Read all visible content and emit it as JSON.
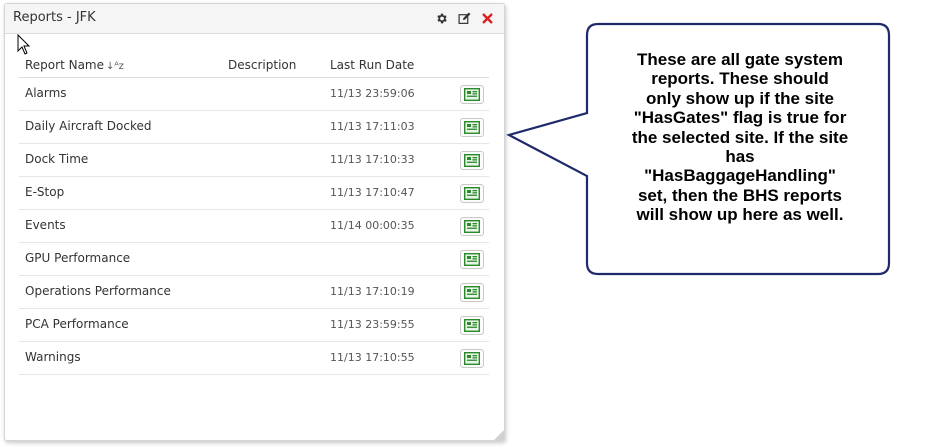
{
  "window": {
    "title": "Reports - JFK"
  },
  "icons": {
    "settings": "gear-icon",
    "edit": "edit-icon",
    "close": "close-icon",
    "run": "report-icon",
    "sort": "sort-ascending-icon"
  },
  "colors": {
    "close": "#dd1f1f",
    "run_icon": "#2a8a2a",
    "callout_border": "#1f2a6b"
  },
  "table": {
    "headers": {
      "name": "Report Name",
      "description": "Description",
      "last_run": "Last Run Date"
    },
    "rows": [
      {
        "name": "Alarms",
        "description": "",
        "last_run": "11/13 23:59:06"
      },
      {
        "name": "Daily Aircraft Docked",
        "description": "",
        "last_run": "11/13 17:11:03"
      },
      {
        "name": "Dock Time",
        "description": "",
        "last_run": "11/13 17:10:33"
      },
      {
        "name": "E-Stop",
        "description": "",
        "last_run": "11/13 17:10:47"
      },
      {
        "name": "Events",
        "description": "",
        "last_run": "11/14 00:00:35"
      },
      {
        "name": "GPU Performance",
        "description": "",
        "last_run": ""
      },
      {
        "name": "Operations Performance",
        "description": "",
        "last_run": "11/13 17:10:19"
      },
      {
        "name": "PCA Performance",
        "description": "",
        "last_run": "11/13 23:59:55"
      },
      {
        "name": "Warnings",
        "description": "",
        "last_run": "11/13 17:10:55"
      }
    ]
  },
  "callout": {
    "lines": [
      "These are all gate system",
      "reports. These should",
      "only show up if the site",
      "\"HasGates\" flag is true for",
      "the selected site. If the site",
      "has",
      "\"HasBaggageHandling\"",
      "set, then the BHS reports",
      "will show up here as well."
    ]
  }
}
